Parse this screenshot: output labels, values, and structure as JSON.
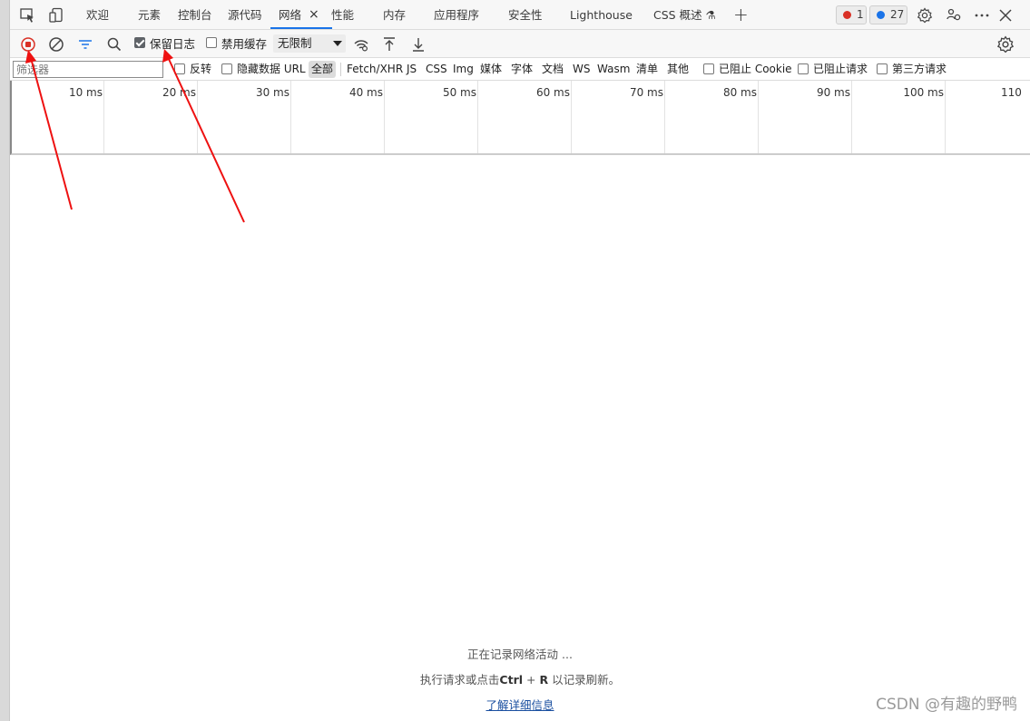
{
  "tabs": [
    {
      "label": "欢迎"
    },
    {
      "label": "元素"
    },
    {
      "label": "控制台"
    },
    {
      "label": "源代码"
    },
    {
      "label": "网络",
      "active": true
    },
    {
      "label": "性能"
    },
    {
      "label": "内存"
    },
    {
      "label": "应用程序"
    },
    {
      "label": "安全性"
    },
    {
      "label": "Lighthouse"
    },
    {
      "label": "CSS 概述 ⚗"
    }
  ],
  "tab_close": "×",
  "add_tab": "+",
  "errors_count": "1",
  "messages_count": "27",
  "toolbar": {
    "preserve_log_label": "保留日志",
    "preserve_log_checked": true,
    "disable_cache_label": "禁用缓存",
    "disable_cache_checked": false,
    "throttle_value": "无限制"
  },
  "filter": {
    "placeholder": "筛选器",
    "invert_label": "反转",
    "hide_data_urls_label": "隐藏数据 URL",
    "types": [
      "全部",
      "Fetch/XHR",
      "JS",
      "CSS",
      "Img",
      "媒体",
      "字体",
      "文档",
      "WS",
      "Wasm",
      "清单",
      "其他"
    ],
    "active_type": "全部",
    "blocked_cookies_label": "已阻止 Cookie",
    "blocked_requests_label": "已阻止请求",
    "third_party_label": "第三方请求"
  },
  "timeline": {
    "ticks": [
      "10 ms",
      "20 ms",
      "30 ms",
      "40 ms",
      "50 ms",
      "60 ms",
      "70 ms",
      "80 ms",
      "90 ms",
      "100 ms",
      "110"
    ]
  },
  "empty_state": {
    "recording": "正在记录网络活动 ...",
    "hint_prefix": "执行请求或点击",
    "hint_key1": "Ctrl",
    "hint_plus": " + ",
    "hint_key2": "R",
    "hint_suffix": " 以记录刷新。",
    "learn_more": "了解详细信息"
  },
  "watermark": "CSDN @有趣的野鸭",
  "colors": {
    "accent": "#1a73e8",
    "record_red": "#d93025",
    "annotation_arrow": "#ee1111"
  }
}
